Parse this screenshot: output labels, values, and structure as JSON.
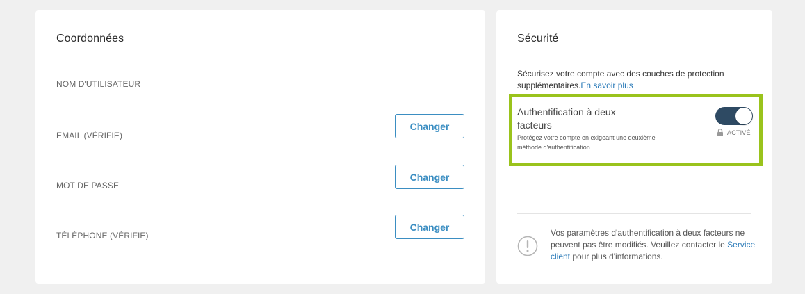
{
  "coordinates": {
    "title": "Coordonnées",
    "fields": [
      {
        "label": "NOM D'UTILISATEUR"
      },
      {
        "label": "EMAIL (VÉRIFIE)",
        "button": "Changer"
      },
      {
        "label": "MOT DE PASSE",
        "button": "Changer"
      },
      {
        "label": "TÉLÉPHONE (VÉRIFIE)",
        "button": "Changer"
      }
    ]
  },
  "security": {
    "title": "Sécurité",
    "description": "Sécurisez votre compte avec des couches de protection supplémentaires.",
    "learn_more": "En savoir plus",
    "two_factor": {
      "title": "Authentification à deux facteurs",
      "subtitle": "Protégez votre compte en exigeant une deuxième méthode d'authentification.",
      "status": "ACTIVÉ",
      "enabled": true
    },
    "notice": {
      "text_before": "Vos paramètres d'authentification à deux facteurs ne peuvent pas être modifiés. Veuillez contacter le",
      "link": "Service client",
      "text_after": "pour plus d'informations."
    }
  },
  "colors": {
    "accent": "#3b8ec2",
    "highlight": "#9ac31c",
    "toggle_on": "#2e4a63",
    "background": "#f0f0f0"
  }
}
